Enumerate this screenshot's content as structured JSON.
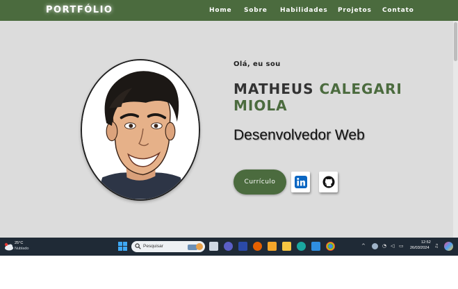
{
  "nav": {
    "brand": "PORTFÓLIO",
    "links": [
      "Home",
      "Sobre",
      "Habilidades",
      "Projetos",
      "Contato"
    ]
  },
  "hero": {
    "greeting": "Olá, eu sou",
    "name_first": "MATHEUS ",
    "name_accent": "CALEGARI MIOLA",
    "role": "Desenvolvedor Web",
    "cv_label": "Currículo",
    "socials": [
      "linkedin-icon",
      "github-icon"
    ]
  },
  "taskbar": {
    "weather_temp": "25°C",
    "weather_condition": "Nublado",
    "search_placeholder": "Pesquisar",
    "time": "12:52",
    "date": "26/03/2024"
  },
  "colors": {
    "accent": "#4b6b3e",
    "page_bg": "#dcdcdc",
    "taskbar_bg": "#1f2a36"
  }
}
